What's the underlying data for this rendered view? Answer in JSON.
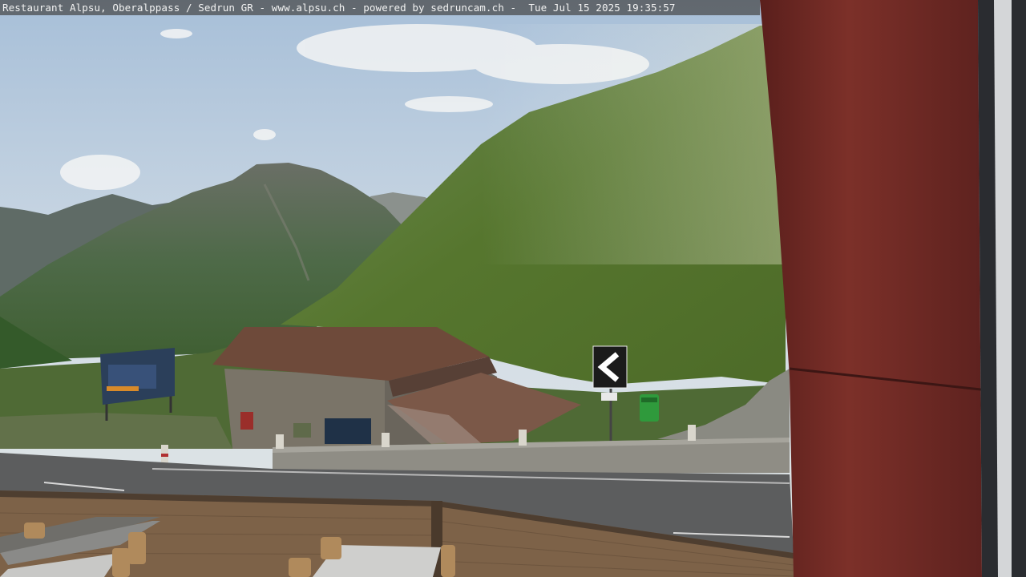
{
  "webcam": {
    "caption": "Restaurant Alpsu, Oberalppass / Sedrun GR - www.alpsu.ch - powered by sedruncam.ch -  Tue Jul 15 2025 19:35:57"
  },
  "colors": {
    "sky": "#c9d8e6",
    "mountain_far": "#5c6a62",
    "mountain_mid": "#4a6b3e",
    "slope_grass": "#5d7f30",
    "barn_roof": "#6e4a3a",
    "barn_wall": "#7a7468",
    "road": "#5f5f5f",
    "post_red": "#7a2e28",
    "fence_wood": "#8a6c4e"
  },
  "icons": [
    "road-chevron-sign",
    "green-trash-bin",
    "billboard"
  ]
}
